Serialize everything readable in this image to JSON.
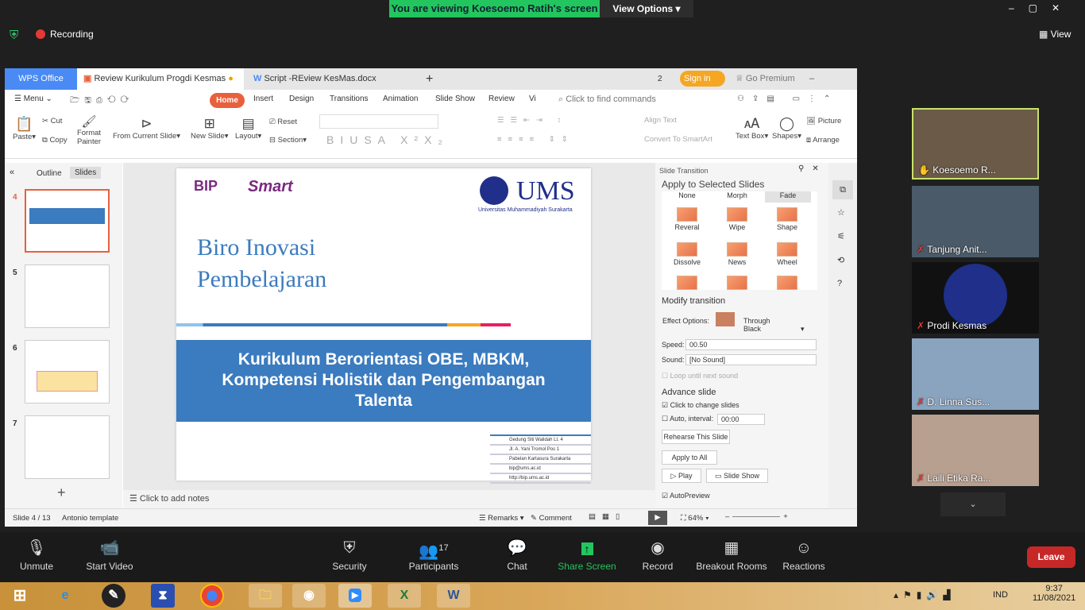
{
  "zoom": {
    "banner": "You are viewing Koesoemo Ratih's screen",
    "view_options": "View Options",
    "recording": "Recording",
    "view": "View",
    "toolbar": [
      {
        "label": "Unmute",
        "icon": "mic-muted-icon"
      },
      {
        "label": "Start Video",
        "icon": "video-off-icon"
      },
      {
        "label": "Security",
        "icon": "shield-icon"
      },
      {
        "label": "Participants",
        "icon": "participants-icon",
        "count": "17"
      },
      {
        "label": "Chat",
        "icon": "chat-icon"
      },
      {
        "label": "Share Screen",
        "icon": "share-screen-icon"
      },
      {
        "label": "Record",
        "icon": "record-icon"
      },
      {
        "label": "Breakout Rooms",
        "icon": "breakout-icon"
      },
      {
        "label": "Reactions",
        "icon": "reactions-icon"
      }
    ],
    "leave": "Leave",
    "share_color": "#23c55e",
    "leave_color": "#c62828",
    "participants": [
      "Koesoemo R...",
      "Tanjung Anit...",
      "Prodi Kesmas",
      "D. Linna Sus...",
      "Laili Etika Ra..."
    ]
  },
  "wps": {
    "app_tab": "WPS Office",
    "doc_tab": "Review Kurikulum Progdi Kesmas",
    "doc_tab2": "Script -REview KesMas.docx",
    "badge": "2",
    "sign_in": "Sign in",
    "premium": "Go Premium",
    "menu": "Menu",
    "ribbon_tabs": [
      "Home",
      "Insert",
      "Design",
      "Transitions",
      "Animation",
      "Slide Show",
      "Review",
      "Vi"
    ],
    "search": "Click to find commands",
    "tools": {
      "paste": "Paste",
      "cut": "Cut",
      "copy": "Copy",
      "format_painter": "Format Painter",
      "from_current": "From Current Slide",
      "new_slide": "New Slide",
      "layout": "Layout",
      "reset": "Reset",
      "section": "Section",
      "align_text": "Align Text",
      "smartart": "Convert To SmartArt",
      "text_box": "Text Box",
      "shapes": "Shapes",
      "picture": "Picture",
      "arrange": "Arrange"
    },
    "pane_tabs": [
      "Outline",
      "Slides"
    ],
    "thumbs": [
      "4",
      "5",
      "6",
      "7"
    ],
    "slide": {
      "logo1": "BIP",
      "logo1_sub": "Biro Inovasi Pembelajaran",
      "logo2": "Smart",
      "ums": "UMS",
      "ums_sub": "Universitas Muhammadiyah Surakarta",
      "title1": "Biro Inovasi",
      "title2": "Pembelajaran",
      "banner": "Kurikulum Berorientasi OBE, MBKM, Kompetensi Holistik dan Pengembangan Talenta",
      "address": [
        "Gedung Siti Walidah Lt. 4",
        "Jl. A. Yani Tromol Pos 1",
        "Pabelan Kartasura Surakarta",
        "bip@ums.ac.id",
        "http://bip.ums.ac.id"
      ],
      "accent": "#3b7bbf"
    },
    "notes": "Click to add notes",
    "panel": {
      "title": "Slide Transition",
      "apply": "Apply to Selected Slides",
      "effects": [
        "None",
        "Morph",
        "Fade",
        "Reveral",
        "Wipe",
        "Shape",
        "Dissolve",
        "News",
        "Wheel"
      ],
      "selected": "Fade",
      "modify": "Modify transition",
      "effect_options_label": "Effect Options:",
      "effect_options": "Through Black",
      "speed_label": "Speed:",
      "speed": "00.50",
      "sound_label": "Sound:",
      "sound": "[No Sound]",
      "loop": "Loop until next sound",
      "advance": "Advance slide",
      "click_change": "Click to change slides",
      "auto": "Auto, interval:",
      "interval": "00:00",
      "rehearse": "Rehearse This Slide",
      "apply_all": "Apply to All",
      "play": "Play",
      "slide_show": "Slide Show",
      "autopreview": "AutoPreview"
    },
    "status": {
      "slide": "Slide 4 / 13",
      "template": "Antonio template",
      "remarks": "Remarks",
      "comment": "Comment",
      "zoom": "64%"
    }
  },
  "taskbar": {
    "lang": "IND",
    "time": "9:37",
    "date": "11/08/2021"
  }
}
